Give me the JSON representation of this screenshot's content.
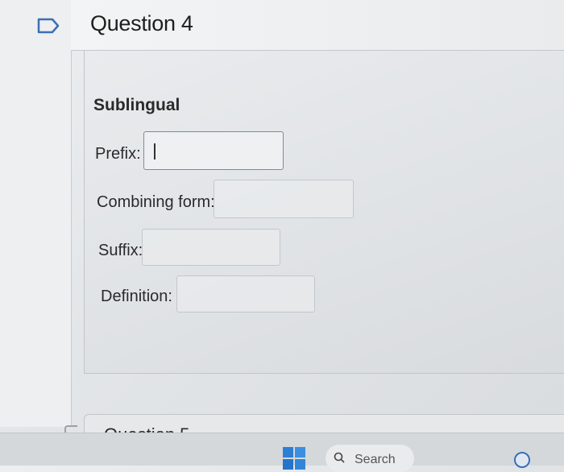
{
  "question": {
    "title": "Question 4",
    "term": "Sublingual"
  },
  "fields": {
    "prefix": {
      "label": "Prefix:",
      "value": ""
    },
    "combining_form": {
      "label": "Combining form:",
      "value": ""
    },
    "suffix": {
      "label": "Suffix:",
      "value": ""
    },
    "definition": {
      "label": "Definition:",
      "value": ""
    }
  },
  "next_question": {
    "title": "Question 5"
  },
  "taskbar": {
    "search_label": "Search"
  },
  "icons": {
    "flag": "flag-icon",
    "start": "windows-start-icon",
    "search": "search-icon"
  }
}
